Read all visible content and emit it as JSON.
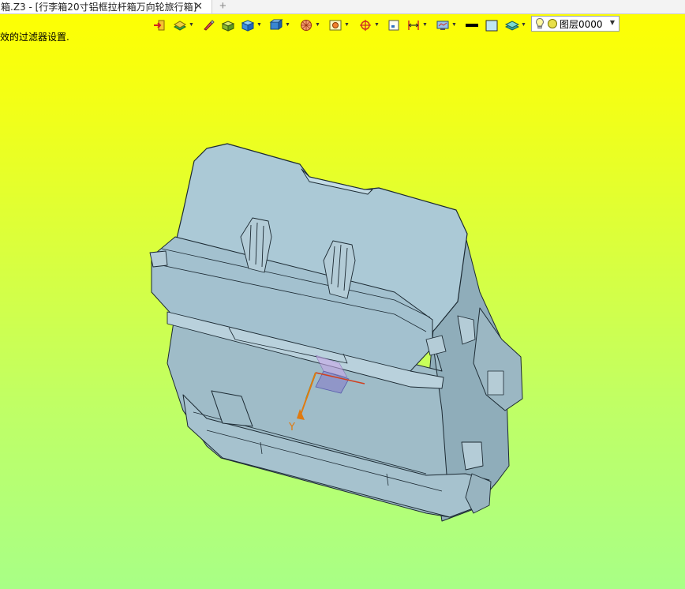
{
  "window": {
    "tab_title": "箱.Z3 - [行李箱20寸铝框拉杆箱万向轮旅行箱]",
    "close_glyph": "✕",
    "new_tab_glyph": "+"
  },
  "status": {
    "hint": "效的过滤器设置."
  },
  "toolbar": {
    "buttons": [
      {
        "id": "import-icon",
        "has_dropdown": false
      },
      {
        "id": "layer-tools-icon",
        "has_dropdown": true
      },
      {
        "id": "pen-icon",
        "has_dropdown": false
      },
      {
        "id": "solid-box-icon",
        "has_dropdown": false
      },
      {
        "id": "blue-cube-icon",
        "has_dropdown": true
      },
      {
        "id": "view-cube-icon",
        "has_dropdown": true
      },
      {
        "id": "render-sphere-icon",
        "has_dropdown": true
      },
      {
        "id": "view-frame-icon",
        "has_dropdown": true
      },
      {
        "id": "pivot-icon",
        "has_dropdown": true
      },
      {
        "id": "snap-grid-icon",
        "has_dropdown": false
      },
      {
        "id": "dimension-icon",
        "has_dropdown": true
      },
      {
        "id": "display-settings-icon",
        "has_dropdown": true
      },
      {
        "id": "line-color-icon",
        "has_dropdown": false
      },
      {
        "id": "fill-color-icon",
        "has_dropdown": false
      },
      {
        "id": "layer-stack-icon",
        "has_dropdown": true
      }
    ],
    "layer": {
      "name": "图层0000",
      "icons": [
        "bulb-icon",
        "layer-color-dot-icon"
      ]
    }
  },
  "scene": {
    "axis_label_y": "Y",
    "colors": {
      "background_top": "#ffff00",
      "background_bottom": "#a8ff86",
      "model_body": "#a9c6d2",
      "model_edge": "#1c2a33",
      "axis_y": "#e07a10",
      "axis_x": "#d04020",
      "axis_z": "#2f9a3a"
    }
  }
}
